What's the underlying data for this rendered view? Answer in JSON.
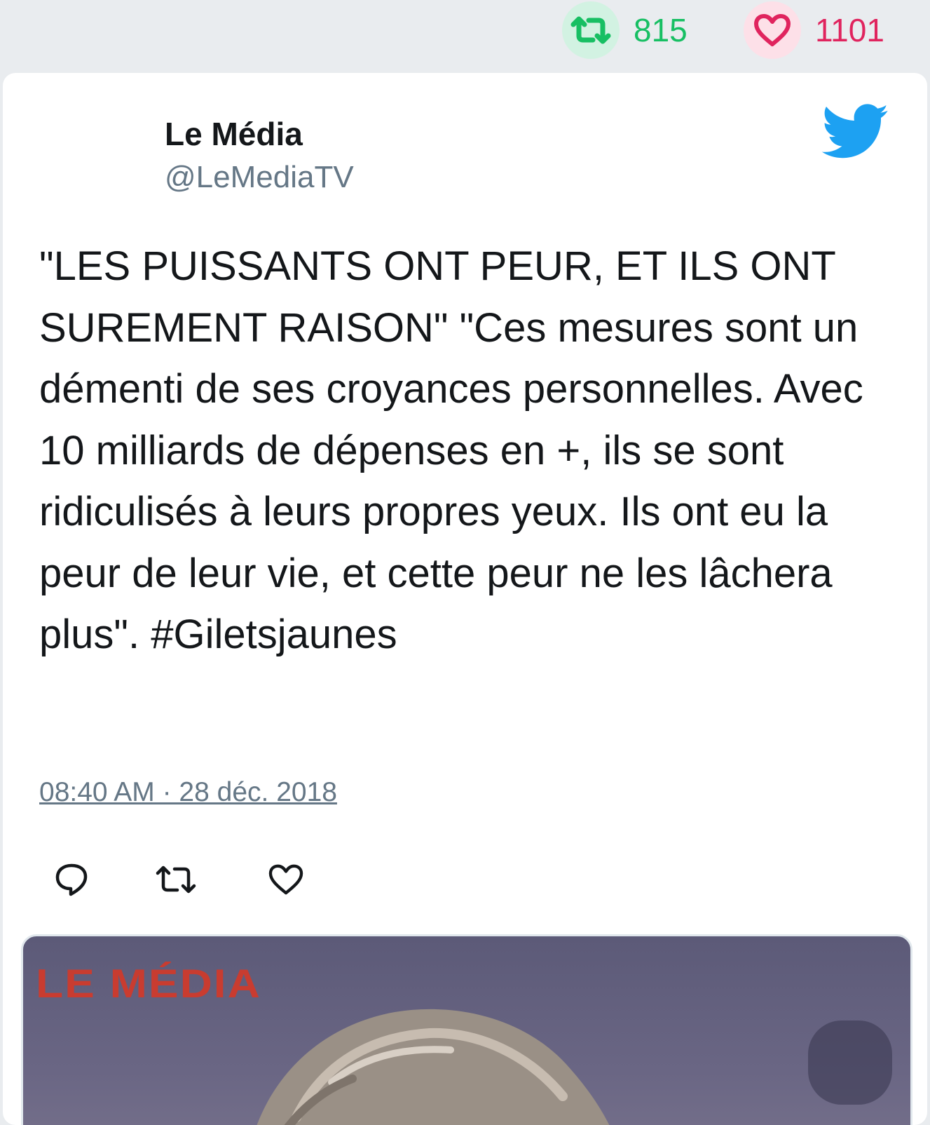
{
  "stats": {
    "retweets": "815",
    "likes": "1101"
  },
  "author": {
    "name": "Le Média",
    "handle": "@LeMediaTV"
  },
  "tweet": {
    "text": "\"LES PUISSANTS ONT PEUR, ET ILS ONT SUREMENT RAISON\" \"Ces mesures sont un démenti de ses croyances personnelles. Avec 10 milliards de dépenses en +, ils se sont ridiculisés à leurs propres yeux. Ils ont eu la peur de leur vie, et cette peur ne les lâchera plus\". #Giletsjaunes",
    "timestamp": "08:40 AM · 28 déc. 2018"
  },
  "media": {
    "logo_text": "LE MÉDIA"
  },
  "colors": {
    "retweet_green": "#17bf63",
    "like_red": "#e0245e",
    "twitter_blue": "#1da1f2",
    "muted_gray": "#657786"
  },
  "icons": {
    "retweet": "retweet-icon",
    "like": "heart-icon",
    "reply": "reply-icon",
    "brand": "twitter-bird-icon"
  }
}
